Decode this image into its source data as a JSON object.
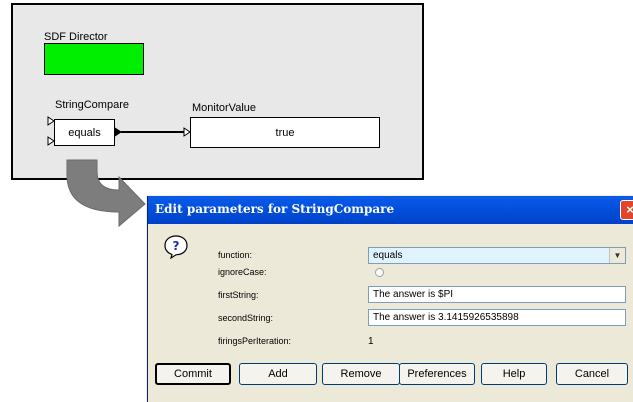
{
  "canvas": {
    "director_label": "SDF Director",
    "actors": {
      "string_compare": {
        "name": "StringCompare",
        "text": "equals"
      },
      "monitor_value": {
        "name": "MonitorValue",
        "text": "true"
      }
    },
    "colors": {
      "director_fill": "#00ee00",
      "background": "#e8e8e8"
    }
  },
  "dialog": {
    "title": "Edit parameters for StringCompare",
    "close_icon": "close-icon",
    "params": {
      "function": {
        "label": "function:",
        "value": "equals"
      },
      "ignore_case": {
        "label": "ignoreCase:",
        "checked": false
      },
      "first_string": {
        "label": "firstString:",
        "value": "The answer is $PI"
      },
      "second_string": {
        "label": "secondString:",
        "value": "The answer is 3.1415926535898"
      },
      "firings": {
        "label": "firingsPerIteration:",
        "value": "1"
      }
    },
    "buttons": {
      "commit": "Commit",
      "add": "Add",
      "remove": "Remove",
      "preferences": "Preferences",
      "help": "Help",
      "cancel": "Cancel"
    },
    "colors": {
      "titlebar": "#0451df",
      "close": "#e1452b",
      "body": "#ece9d8"
    }
  }
}
